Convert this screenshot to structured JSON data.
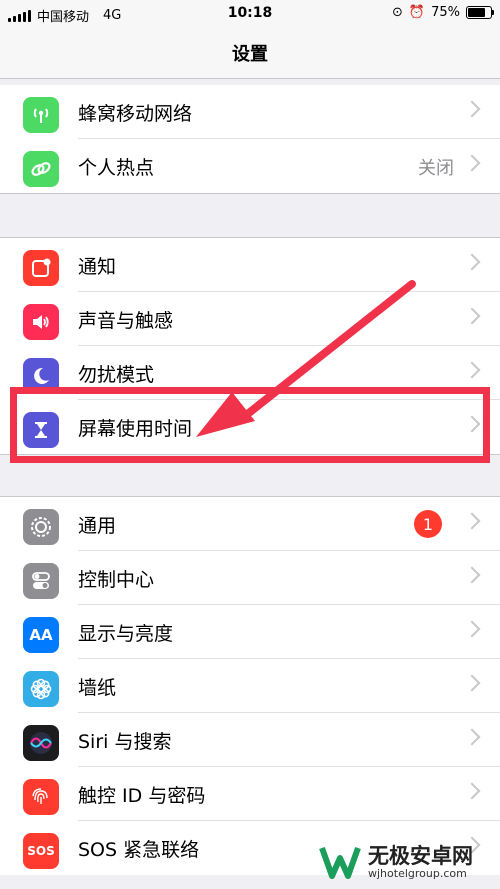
{
  "status_bar": {
    "carrier": "中国移动",
    "network": "4G",
    "time": "10:18",
    "battery_percent": "75%",
    "battery_level": 0.75
  },
  "nav": {
    "title": "设置"
  },
  "groups": [
    {
      "rows": [
        {
          "label": "蜂窝移动网络",
          "icon": "cellular-icon",
          "color": "#4cd964"
        },
        {
          "label": "个人热点",
          "icon": "hotspot-icon",
          "color": "#4cd964",
          "value": "关闭"
        }
      ]
    },
    {
      "rows": [
        {
          "label": "通知",
          "icon": "notifications-icon",
          "color": "#ff3b30"
        },
        {
          "label": "声音与触感",
          "icon": "sound-icon",
          "color": "#ff2d55"
        },
        {
          "label": "勿扰模式",
          "icon": "moon-icon",
          "color": "#5856d6"
        },
        {
          "label": "屏幕使用时间",
          "icon": "hourglass-icon",
          "color": "#5856d6"
        }
      ]
    },
    {
      "rows": [
        {
          "label": "通用",
          "icon": "gear-icon",
          "color": "#8e8e93",
          "badge": "1"
        },
        {
          "label": "控制中心",
          "icon": "toggles-icon",
          "color": "#8e8e93"
        },
        {
          "label": "显示与亮度",
          "icon": "display-icon",
          "color": "#007aff",
          "icon_text": "AA"
        },
        {
          "label": "墙纸",
          "icon": "flower-icon",
          "color": "#32ade6"
        },
        {
          "label": "Siri 与搜索",
          "icon": "siri-icon",
          "color": "#1c1c1e"
        },
        {
          "label": "触控 ID 与密码",
          "icon": "fingerprint-icon",
          "color": "#ff3b30"
        },
        {
          "label": "SOS 紧急联络",
          "icon": "sos-icon",
          "color": "#ff3b30",
          "icon_text": "SOS"
        }
      ]
    }
  ],
  "watermark": {
    "name": "无极安卓网",
    "url": "wjhotelgroup.com"
  },
  "annotation": {
    "highlight_color": "#f0334b"
  }
}
